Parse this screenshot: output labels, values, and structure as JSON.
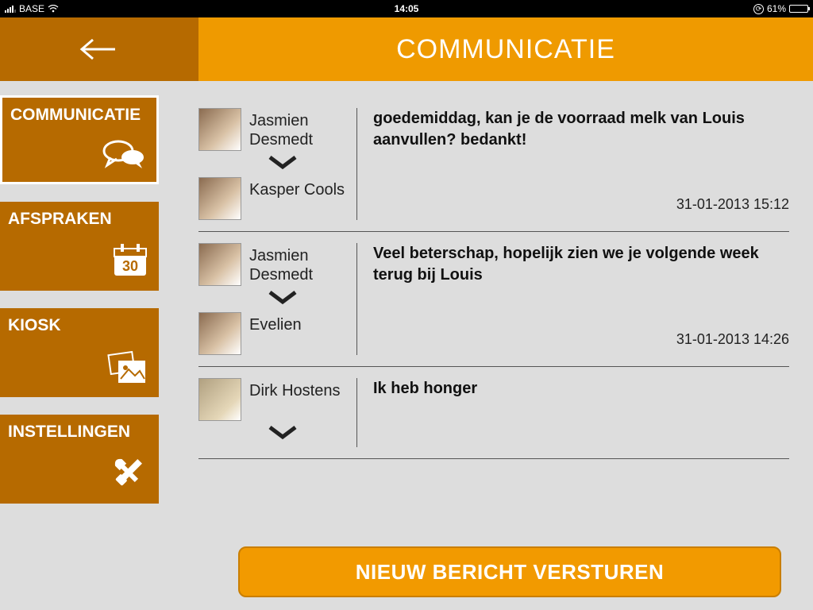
{
  "statusbar": {
    "carrier": "BASE",
    "time": "14:05",
    "battery_percent": "61%"
  },
  "header": {
    "title": "COMMUNICATIE"
  },
  "sidebar": {
    "items": [
      {
        "label": "COMMUNICATIE"
      },
      {
        "label": "AFSPRAKEN",
        "calendar_day": "30"
      },
      {
        "label": "KIOSK"
      },
      {
        "label": "INSTELLINGEN"
      }
    ]
  },
  "messages": [
    {
      "from": "Jasmien Desmedt",
      "to": "Kasper Cools",
      "body": "goedemiddag, kan je de voorraad melk van Louis aanvullen?  bedankt!",
      "timestamp": "31-01-2013 15:12"
    },
    {
      "from": "Jasmien Desmedt",
      "to": "Evelien",
      "body": "Veel beterschap, hopelijk zien we je volgende week terug bij Louis",
      "timestamp": "31-01-2013 14:26"
    },
    {
      "from": "Dirk Hostens",
      "to": "",
      "body": "Ik heb honger",
      "timestamp": ""
    }
  ],
  "compose_button": "NIEUW BERICHT VERSTUREN"
}
